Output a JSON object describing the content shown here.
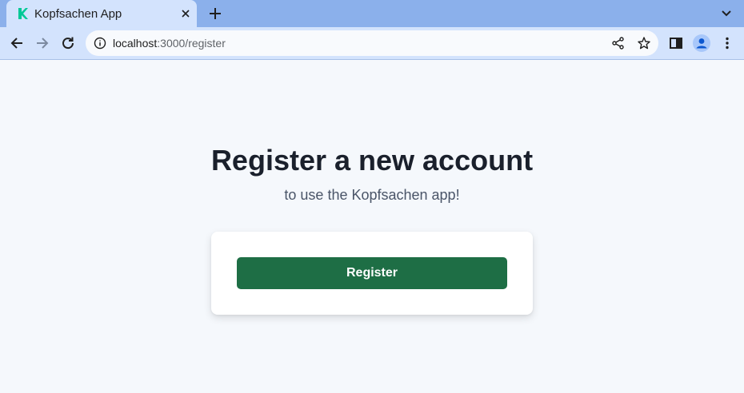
{
  "browser": {
    "tab": {
      "title": "Kopfsachen App",
      "favicon": "kopfsachen-k-logo"
    },
    "omnibox": {
      "host": "localhost",
      "path": ":3000/register"
    },
    "icons": [
      "back-arrow-icon",
      "forward-arrow-icon",
      "reload-icon",
      "info-icon",
      "share-icon",
      "star-icon",
      "side-panel-icon",
      "profile-avatar-icon",
      "more-vert-icon",
      "close-icon",
      "plus-icon",
      "chevron-down-icon"
    ]
  },
  "page": {
    "title": "Register a new account",
    "subtitle": "to use the Kopfsachen app!",
    "register_label": "Register"
  },
  "colors": {
    "tabstrip": "#8bb0eb",
    "toolbar": "#d3e3fd",
    "page_background": "#f5f8fc",
    "button": "#1e6e45",
    "favicon": "#00c896"
  }
}
